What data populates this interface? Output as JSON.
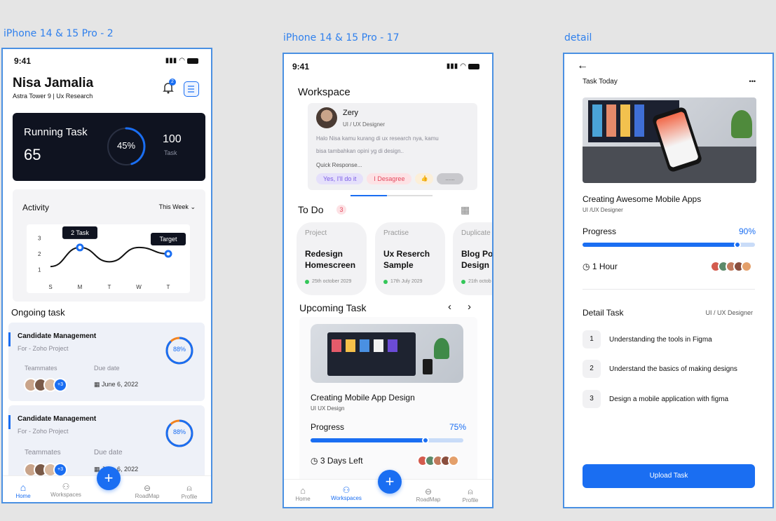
{
  "frames": {
    "left": "iPhone 14 & 15 Pro - 2",
    "middle": "iPhone 14 & 15 Pro - 17",
    "right": "detail"
  },
  "status_time": "9:41",
  "screen1": {
    "name": "Nisa Jamalia",
    "subtitle": "Astra Tower 9 | Ux Research",
    "notif_count": "2",
    "running_title": "Running Task",
    "running_value": "65",
    "running_percent": "45%",
    "running_percent_value": 45,
    "task_total": "100",
    "task_label": "Task",
    "activity_title": "Activity",
    "period": "This Week",
    "chart_data": {
      "type": "line",
      "categories": [
        "S",
        "M",
        "T",
        "W",
        "T"
      ],
      "values": [
        1.2,
        2.4,
        1.5,
        2.4,
        2.0
      ],
      "ylim": [
        0.5,
        3.5
      ],
      "yticks": [
        "1",
        "2",
        "3"
      ],
      "annotations": [
        "2 Task",
        "Target"
      ]
    },
    "ongoing_title": "Ongoing task",
    "tasks": [
      {
        "title": "Candidate Management",
        "project": "For - Zoho Project",
        "teammates_label": "Teammates",
        "due_label": "Due date",
        "due": "June 6, 2022",
        "extra": "+3",
        "percent": "88%",
        "percent_value": 88
      },
      {
        "title": "Candidate Management",
        "project": "For - Zoho Project",
        "teammates_label": "Teammates",
        "due_label": "Due date",
        "due": "June 6, 2022",
        "extra": "+3",
        "percent": "88%",
        "percent_value": 88
      }
    ],
    "nav": [
      "Home",
      "Workspaces",
      "RoadMap",
      "Profile"
    ],
    "fab": "+"
  },
  "screen2": {
    "title": "Workspace",
    "msg_name": "Zery",
    "msg_role": "UI / UX Designer",
    "msg_text1": "Halo Nisa kamu kurang di ux research nya, kamu",
    "msg_text2": "bisa tambahkan opini yg di design..",
    "quick": "Quick Response...",
    "replies": [
      "Yes, I'll do it",
      "I Desagree",
      "👍",
      "......"
    ],
    "todo_title": "To Do",
    "todo_count": "3",
    "todos": [
      {
        "cat": "Project",
        "title": "Redesign Homescreen",
        "date": "25th october 2029"
      },
      {
        "cat": "Practise",
        "title": "Ux Reserch Sample",
        "date": "17th July 2029"
      },
      {
        "cat": "Duplicate",
        "title": "Blog Post Design",
        "date": "21th octob"
      }
    ],
    "upcoming_title": "Upcoming Task",
    "card_title": "Creating Mobile App Design",
    "card_sub": "UI UX Design",
    "progress_label": "Progress",
    "progress_text": "75%",
    "progress_value": 75,
    "days_left": "3 Days Left",
    "nav": [
      "Home",
      "Workspaces",
      "RoadMap",
      "Profile"
    ],
    "fab": "+"
  },
  "screen3": {
    "header": "Task Today",
    "more": "•••",
    "title": "Creating Awesome Mobile Apps",
    "sub": "UI /UX Designer",
    "progress_label": "Progress",
    "progress_text": "90%",
    "progress_value": 90,
    "duration": "1 Hour",
    "detail_title": "Detail Task",
    "detail_role": "UI / UX Designer",
    "steps": [
      {
        "n": "1",
        "text": "Understanding the tools in Figma"
      },
      {
        "n": "2",
        "text": "Understand the basics of making designs"
      },
      {
        "n": "3",
        "text": "Design a mobile application with figma"
      }
    ],
    "upload": "Upload Task"
  },
  "colors": {
    "accent": "#1a6ef2",
    "dark": "#0f1320",
    "orange": "#f2821e"
  }
}
